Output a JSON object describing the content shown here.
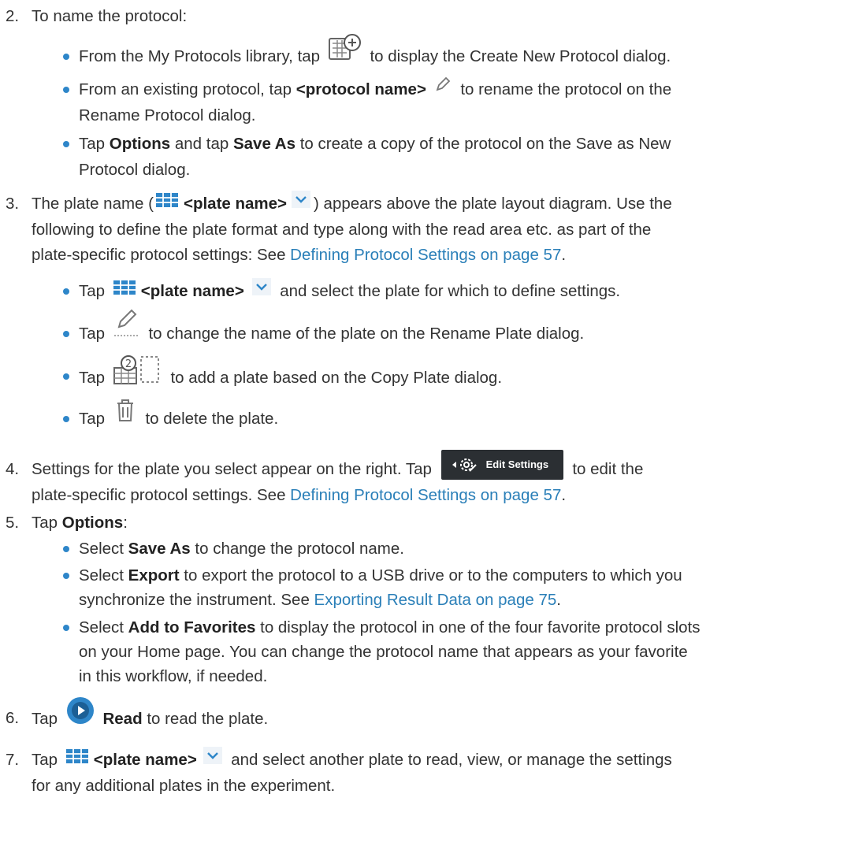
{
  "steps": [
    {
      "num": "2.",
      "text": "To name the protocol:"
    },
    {
      "num": "3.",
      "line1_a": "The plate name (",
      "line1_b": "<plate name>",
      "line1_c": ") appears above the plate layout diagram. Use the",
      "line2": "following to define the plate format and type along with the read area etc. as part of the",
      "line3_a": "plate-specific protocol settings: See ",
      "line3_link": "Defining Protocol Settings on page 57",
      "line3_b": "."
    },
    {
      "num": "4.",
      "line1_a": "Settings for the plate you select appear on the right. Tap",
      "line1_b": "to edit the",
      "line2_a": "plate-specific protocol settings. See ",
      "line2_link": "Defining Protocol Settings on page 57",
      "line2_b": "."
    },
    {
      "num": "5.",
      "a": "Tap ",
      "b": "Options",
      "c": ":"
    },
    {
      "num": "6.",
      "a": "Tap",
      "b": "Read",
      "c": "to read the plate."
    },
    {
      "num": "7.",
      "a": "Tap",
      "b": "<plate name>",
      "c": "and select another plate to read, view, or manage the settings",
      "line2": "for any additional plates in the experiment."
    }
  ],
  "step2_bullets": {
    "b1_a": "From the My Protocols library, tap",
    "b1_b": "to display the Create New Protocol dialog.",
    "b2_a": "From an existing protocol, tap ",
    "b2_b": "<protocol name>",
    "b2_c": "to rename the protocol on the",
    "b2_line2": "Rename Protocol dialog.",
    "b3_a": "Tap ",
    "b3_b": "Options",
    "b3_c": " and tap ",
    "b3_d": "Save As",
    "b3_e": " to create a copy of the protocol on the Save as New",
    "b3_line2": "Protocol dialog."
  },
  "step3_bullets": {
    "b1_a": "Tap",
    "b1_b": "<plate name>",
    "b1_c": "and select the plate for which to define settings.",
    "b2_a": "Tap",
    "b2_b": "to change the name of the plate on the Rename Plate dialog.",
    "b3_a": "Tap",
    "b3_b": "to add a plate based on the Copy Plate dialog.",
    "b4_a": "Tap",
    "b4_b": "to delete the plate."
  },
  "edit_settings_label": "Edit Settings",
  "step5_bullets": {
    "b1_a": "Select ",
    "b1_b": "Save As",
    "b1_c": " to change the protocol name.",
    "b2_a": "Select ",
    "b2_b": "Export",
    "b2_c": " to export the protocol to a USB drive or to the computers to which you",
    "b2_line2_a": "synchronize the instrument. See ",
    "b2_line2_link": "Exporting Result Data on page 75",
    "b2_line2_b": ".",
    "b3_a": "Select ",
    "b3_b": "Add to Favorites",
    "b3_c": " to display the protocol in one of the four favorite protocol slots",
    "b3_line2": "on your Home page. You can change the protocol name that appears as your favorite",
    "b3_line3": "in this workflow, if needed."
  },
  "colors": {
    "accent": "#2e86c9",
    "link": "#2a7fb8",
    "text": "#333333"
  },
  "icons": [
    "create-protocol-icon",
    "pencil-icon",
    "plate-grid-icon",
    "chevron-down-icon",
    "rename-plate-icon",
    "copy-plate-icon",
    "trash-icon",
    "settings-gear-icon",
    "play-read-icon"
  ]
}
